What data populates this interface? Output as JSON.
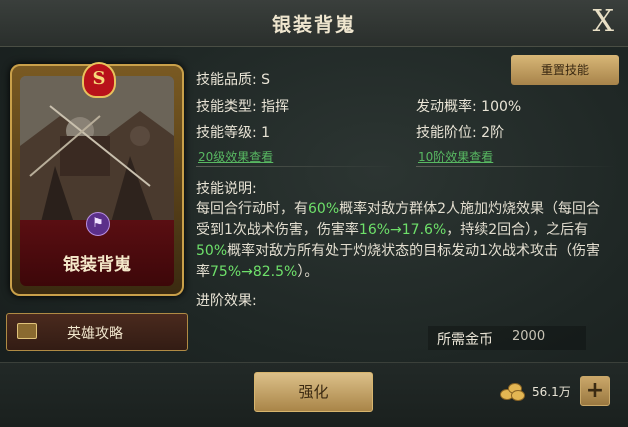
{
  "title": "银装背嵬",
  "close_label": "X",
  "card": {
    "grade": "S",
    "name": "银装背嵬",
    "type_glyph": "⚑"
  },
  "guide_button": "英雄攻略",
  "reset_button": "重置技能",
  "stats": {
    "quality": "技能品质: S",
    "type": "技能类型: 指挥",
    "level": "技能等级: 1",
    "level_link": "20级效果查看",
    "trigger": "发动概率: 100%",
    "tier": "技能阶位: 2阶",
    "tier_link": "10阶效果查看"
  },
  "desc_title": "技能说明:",
  "desc": {
    "p1": "每回合行动时，有",
    "h1": "60%",
    "p2": "概率对敌方群体2人施加灼烧效果（每回合受到1次战术伤害，伤害率",
    "h2": "16%→17.6%",
    "p3": "，持续2回合），之后有",
    "h3": "50%",
    "p4": "概率对敌方所有处于灼烧状态的目标发动1次战术攻击（伤害率",
    "h4": "75%→82.5%",
    "p5": "）。"
  },
  "advanced_title": "进阶效果:",
  "cost": {
    "label": "所需金币",
    "value": "2000"
  },
  "upgrade_button": "强化",
  "gold_amount": "56.1万",
  "plus_label": "+",
  "colors": {
    "highlight": "#6ee06a",
    "link": "#58b862",
    "gold_button": "#d8b777",
    "card_red": "#5a0e12"
  },
  "icons": [
    "close-icon",
    "grade-badge-icon",
    "type-badge-icon",
    "book-icon",
    "coin-icon",
    "plus-icon"
  ]
}
